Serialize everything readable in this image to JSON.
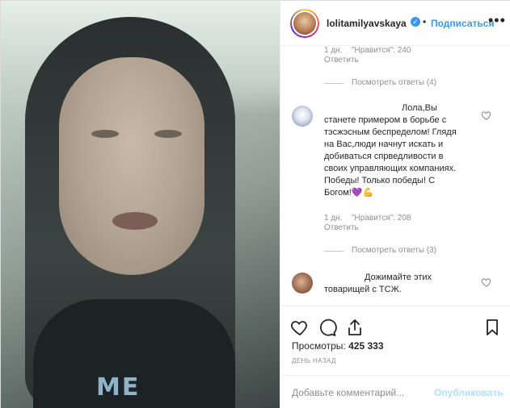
{
  "header": {
    "username": "lolitamilyavskaya",
    "dot": "•",
    "follow_label": "Подписаться",
    "more_label": "•••"
  },
  "comments": {
    "top_meta": {
      "age": "1 дн.",
      "likes": "\"Нравится\": 240",
      "reply_label": "Ответить"
    },
    "view_replies_1": "Посмотреть ответы (4)",
    "comment_1": {
      "text_lines": [
        "Лола,Вы",
        "станете примером в борьбе с",
        "тэсжэсным беспределом! Глядя",
        "на Вас,люди начнут искать и",
        "добиваться спрведливости в",
        "своих управляющих компаниях.",
        "Победы! Только победы! С",
        "Богом!💜💪"
      ],
      "age": "1 дн.",
      "likes": "\"Нравится\": 208",
      "reply_label": "Ответить"
    },
    "view_replies_2": "Посмотреть ответы (3)",
    "comment_2": {
      "text_lines": [
        "Дожимайте этих",
        "товарищей с ТСЖ."
      ]
    }
  },
  "actions": {
    "views_label": "Просмотры:",
    "views_count": "425 333",
    "time_ago": "ДЕНЬ НАЗАД"
  },
  "add_comment": {
    "placeholder": "Добавьте комментарий...",
    "publish_label": "Опубликовать"
  },
  "media": {
    "shirt_text": "ME"
  },
  "colors": {
    "accent": "#3897f0",
    "muted": "#8e8e8e",
    "publish_disabled": "#b2dffc"
  }
}
